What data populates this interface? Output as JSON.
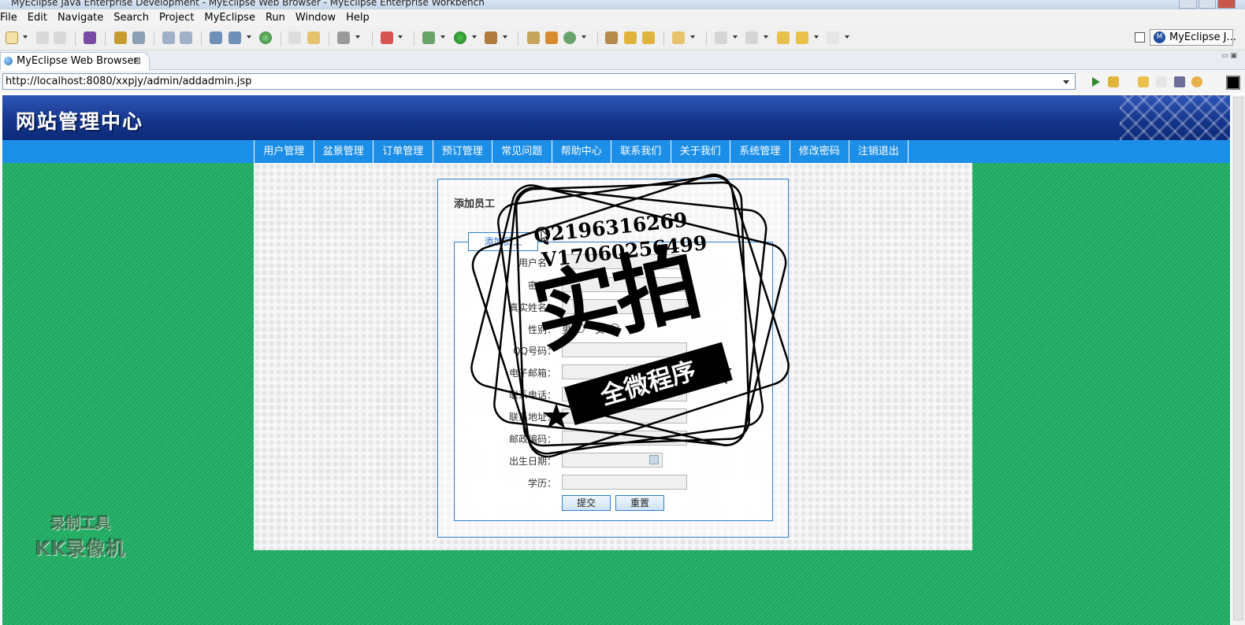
{
  "window": {
    "title": "MyEclipse Java Enterprise Development - MyEclipse Web Browser - MyEclipse Enterprise Workbench"
  },
  "menu": [
    "File",
    "Edit",
    "Navigate",
    "Search",
    "Project",
    "MyEclipse",
    "Run",
    "Window",
    "Help"
  ],
  "perspective": {
    "label": "MyEclipse J..."
  },
  "editor_tab": {
    "label": "MyEclipse Web Browser",
    "close": "⊠"
  },
  "browser": {
    "url": "http://localhost:8080/xxpjy/admin/addadmin.jsp"
  },
  "site": {
    "title": "网站管理中心",
    "nav": [
      "用户管理",
      "盆景管理",
      "订单管理",
      "预订管理",
      "常见问题",
      "帮助中心",
      "联系我们",
      "关于我们",
      "系统管理",
      "修改密码",
      "注销退出"
    ]
  },
  "form": {
    "panel_title": "添加员工",
    "legend": "添加员工",
    "fields": {
      "username": "用户名：",
      "password": "密码：",
      "realname": "真实姓名：",
      "gender": "性别：",
      "qq": "QQ号码：",
      "email": "电子邮箱：",
      "phone": "联系电话：",
      "address": "联系地址：",
      "postcode": "邮政编码：",
      "birthday": "出生日期：",
      "education": "学历："
    },
    "gender_options": {
      "male": "男",
      "female": "女"
    },
    "submit": "提交",
    "reset": "重置"
  },
  "watermark": {
    "line1": "Q2196316269",
    "line2": "V17060256499",
    "big": "实拍",
    "band": "全微程序",
    "recorder_line1": "录制工具",
    "recorder_line2": "KK录像机"
  },
  "colors": {
    "page_background": "#1fa45f",
    "banner": "#15368c",
    "nav_bar": "#1b8ee8",
    "form_border": "#2d7fcf"
  }
}
